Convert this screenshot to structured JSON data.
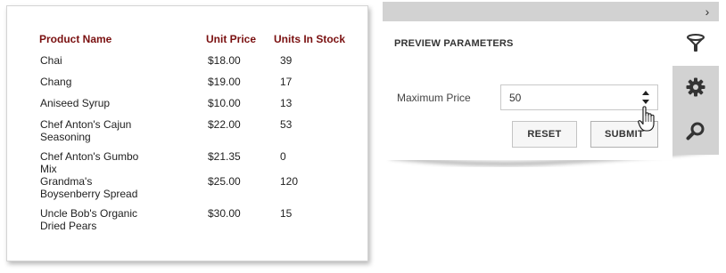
{
  "report": {
    "columns": [
      "Product Name",
      "Unit Price",
      "Units In Stock"
    ],
    "rows": [
      {
        "name": "Chai",
        "price": "$18.00",
        "stock": "39"
      },
      {
        "name": "Chang",
        "price": "$19.00",
        "stock": "17"
      },
      {
        "name": "Aniseed Syrup",
        "price": "$10.00",
        "stock": "13"
      },
      {
        "name": "Chef Anton's Cajun Seasoning",
        "price": "$22.00",
        "stock": "53"
      },
      {
        "name": "Chef Anton's Gumbo Mix",
        "price": "$21.35",
        "stock": "0"
      },
      {
        "name": "Grandma's Boysenberry Spread",
        "price": "$25.00",
        "stock": "120"
      },
      {
        "name": "Uncle Bob's Organic Dried Pears",
        "price": "$30.00",
        "stock": "15"
      }
    ],
    "header_color": "#7a1010"
  },
  "panel": {
    "title": "PREVIEW PARAMETERS",
    "parameter_label": "Maximum Price",
    "parameter_value": "50",
    "reset_label": "RESET",
    "submit_label": "SUBMIT",
    "tabs": [
      "filter-icon",
      "gear-icon",
      "search-icon"
    ],
    "collapse_glyph": "›"
  }
}
